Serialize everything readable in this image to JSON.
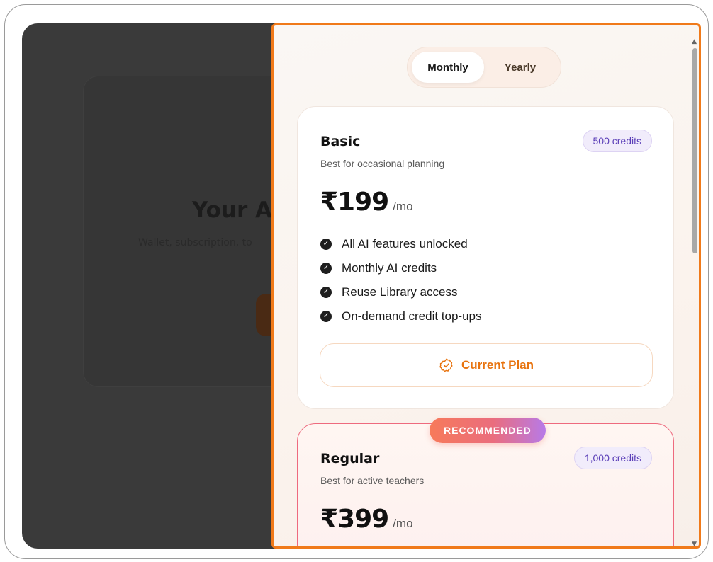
{
  "background_page": {
    "title": "Your A",
    "subtitle": "Wallet, subscription, to"
  },
  "billing_toggle": {
    "options": [
      "Monthly",
      "Yearly"
    ],
    "selected": "Monthly"
  },
  "plans": [
    {
      "name": "Basic",
      "description": "Best for occasional planning",
      "credits": "500 credits",
      "price": "₹199",
      "period": "/mo",
      "features": [
        "All AI features unlocked",
        "Monthly AI credits",
        "Reuse Library access",
        "On-demand credit top-ups"
      ],
      "button_label": "Current Plan"
    },
    {
      "name": "Regular",
      "description": "Best for active teachers",
      "credits": "1,000 credits",
      "price": "₹399",
      "period": "/mo",
      "badge": "RECOMMENDED"
    }
  ],
  "colors": {
    "accent": "#f07a1a",
    "credits_text": "#5b3fb8",
    "recommended_start": "#f77a5a",
    "recommended_end": "#b77ae8"
  }
}
